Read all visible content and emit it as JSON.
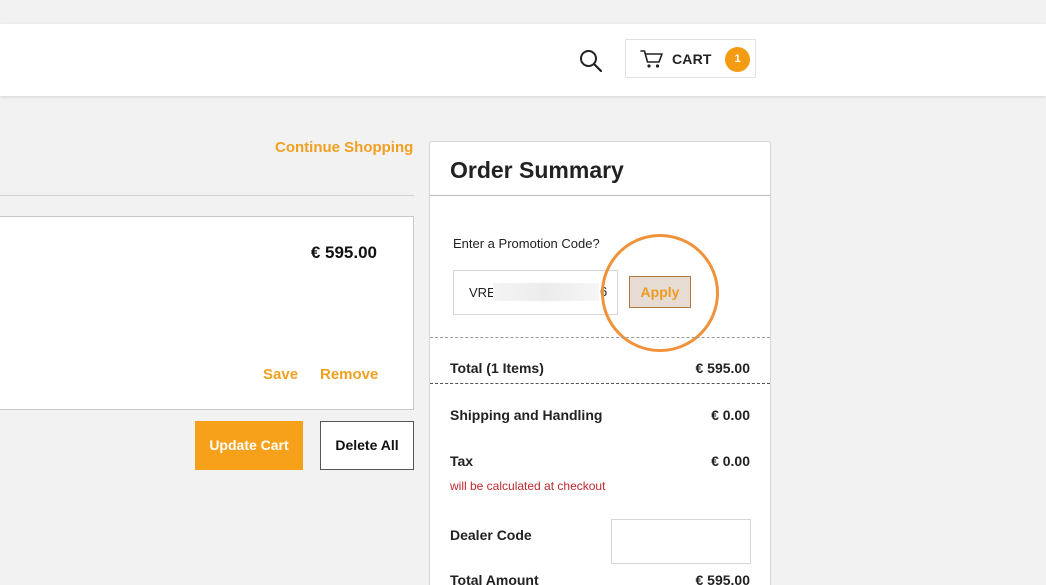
{
  "header": {
    "cart_label": "CART",
    "cart_count": "1"
  },
  "cart": {
    "continue_label": "Continue Shopping",
    "item": {
      "price": "€ 595.00",
      "save_label": "Save",
      "remove_label": "Remove"
    },
    "update_label": "Update Cart",
    "delete_label": "Delete All"
  },
  "summary": {
    "title": "Order Summary",
    "promo_label": "Enter a Promotion Code?",
    "promo_value_start": "VRE",
    "promo_value_end": "6",
    "apply_label": "Apply",
    "total_items_label": "Total (1 Items)",
    "total_items_value": "€ 595.00",
    "shipping_label": "Shipping and Handling",
    "shipping_value": "€ 0.00",
    "tax_label": "Tax",
    "tax_value": "€ 0.00",
    "tax_note": "will be calculated at checkout",
    "dealer_label": "Dealer Code",
    "dealer_value": "",
    "total_amount_label": "Total Amount",
    "total_amount_value": "€ 595.00"
  },
  "colors": {
    "accent": "#f7a01a",
    "link": "#f0a020",
    "warning": "#c0282d"
  }
}
